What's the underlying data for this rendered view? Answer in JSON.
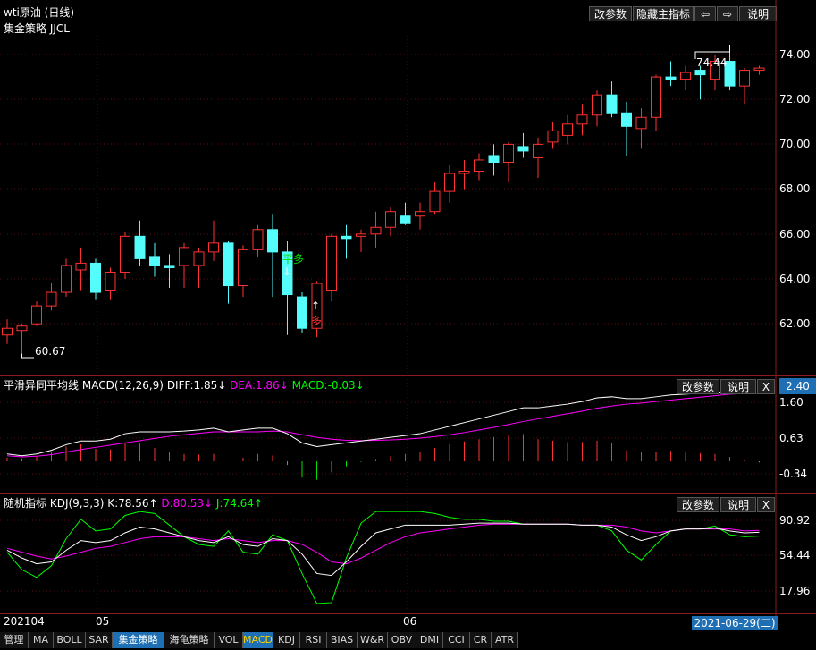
{
  "main": {
    "title": "wti原油 (日线)",
    "subtitle": "集金策略 JJCL",
    "buttons": [
      "改参数",
      "隐藏主指标",
      "⇦",
      "⇨",
      "说明"
    ],
    "y_labels": [
      "74.00",
      "72.00",
      "70.00",
      "68.00",
      "66.00",
      "64.00",
      "62.00"
    ],
    "low_label": "60.67",
    "high_label": "74.44",
    "signal_sell": "平多",
    "signal_buy": "多"
  },
  "macd": {
    "name": "平滑异同平均线",
    "params": "MACD(12,26,9)",
    "diff": "DIFF:1.85↓",
    "dea": "DEA:1.86↓",
    "macd": "MACD:-0.03↓",
    "buttons": [
      "改参数",
      "说明",
      "X"
    ],
    "value_box": "2.40",
    "y_labels": [
      "1.60",
      "0.63",
      "-0.34"
    ]
  },
  "kdj": {
    "name": "随机指标",
    "params": "KDJ(9,3,3)",
    "k": "K:78.56↑",
    "d": "D:80.53↓",
    "j": "J:74.64↑",
    "buttons": [
      "改参数",
      "说明",
      "X"
    ],
    "y_labels": [
      "90.92",
      "54.44",
      "17.96"
    ]
  },
  "x_axis": {
    "labels": [
      "202104",
      "05",
      "06"
    ],
    "date_box": "2021-06-29(二)"
  },
  "tabs": [
    "管理",
    "MA",
    "BOLL",
    "SAR",
    "集金策略",
    "海龟策略",
    "VOL",
    "MACD",
    "KDJ",
    "RSI",
    "BIAS",
    "W&R",
    "OBV",
    "DMI",
    "CCI",
    "CR",
    "ATR"
  ],
  "active_tab": "集金策略",
  "selected_tab": "MACD",
  "colors": {
    "up": "#ff3232",
    "down": "#54fcfc",
    "diff": "#ffffff",
    "dea": "#ff00ff",
    "k": "#ffffff",
    "d": "#ff00ff",
    "j": "#00ff00"
  },
  "chart_data": {
    "type": "candlestick",
    "ylim": [
      60.5,
      75.0
    ],
    "candles": [
      {
        "o": 61.5,
        "h": 62.2,
        "l": 61.1,
        "c": 61.8
      },
      {
        "o": 61.7,
        "h": 62.0,
        "l": 60.67,
        "c": 61.9
      },
      {
        "o": 62.0,
        "h": 63.0,
        "l": 61.9,
        "c": 62.8
      },
      {
        "o": 62.8,
        "h": 63.8,
        "l": 62.6,
        "c": 63.4
      },
      {
        "o": 63.4,
        "h": 64.9,
        "l": 63.2,
        "c": 64.6
      },
      {
        "o": 64.4,
        "h": 65.4,
        "l": 63.5,
        "c": 64.7
      },
      {
        "o": 64.7,
        "h": 64.9,
        "l": 63.1,
        "c": 63.4
      },
      {
        "o": 63.5,
        "h": 64.5,
        "l": 63.1,
        "c": 64.3
      },
      {
        "o": 64.3,
        "h": 66.1,
        "l": 64.0,
        "c": 65.9
      },
      {
        "o": 65.9,
        "h": 66.6,
        "l": 64.6,
        "c": 64.9
      },
      {
        "o": 65.0,
        "h": 65.6,
        "l": 64.1,
        "c": 64.6
      },
      {
        "o": 64.6,
        "h": 65.1,
        "l": 63.6,
        "c": 64.5
      },
      {
        "o": 64.6,
        "h": 65.6,
        "l": 63.6,
        "c": 65.4
      },
      {
        "o": 64.6,
        "h": 65.4,
        "l": 63.6,
        "c": 65.2
      },
      {
        "o": 65.2,
        "h": 66.6,
        "l": 64.8,
        "c": 65.6
      },
      {
        "o": 65.6,
        "h": 65.7,
        "l": 62.9,
        "c": 63.7
      },
      {
        "o": 63.7,
        "h": 65.5,
        "l": 63.2,
        "c": 65.3
      },
      {
        "o": 65.3,
        "h": 66.4,
        "l": 65.0,
        "c": 66.2
      },
      {
        "o": 66.2,
        "h": 66.9,
        "l": 63.2,
        "c": 65.2
      },
      {
        "o": 65.2,
        "h": 65.7,
        "l": 61.5,
        "c": 63.3
      },
      {
        "o": 63.2,
        "h": 63.4,
        "l": 61.6,
        "c": 61.8
      },
      {
        "o": 61.8,
        "h": 63.9,
        "l": 61.4,
        "c": 63.8
      },
      {
        "o": 63.5,
        "h": 66.0,
        "l": 63.0,
        "c": 65.9
      },
      {
        "o": 65.9,
        "h": 66.4,
        "l": 64.9,
        "c": 65.8
      },
      {
        "o": 65.9,
        "h": 66.2,
        "l": 65.2,
        "c": 66.0
      },
      {
        "o": 66.0,
        "h": 67.0,
        "l": 65.4,
        "c": 66.3
      },
      {
        "o": 66.3,
        "h": 67.2,
        "l": 65.9,
        "c": 67.0
      },
      {
        "o": 66.8,
        "h": 67.4,
        "l": 66.4,
        "c": 66.5
      },
      {
        "o": 66.8,
        "h": 67.4,
        "l": 66.2,
        "c": 67.0
      },
      {
        "o": 67.0,
        "h": 68.3,
        "l": 66.9,
        "c": 67.9
      },
      {
        "o": 67.9,
        "h": 69.1,
        "l": 67.4,
        "c": 68.7
      },
      {
        "o": 68.7,
        "h": 69.3,
        "l": 68.0,
        "c": 68.8
      },
      {
        "o": 68.8,
        "h": 69.6,
        "l": 68.4,
        "c": 69.3
      },
      {
        "o": 69.5,
        "h": 70.0,
        "l": 68.6,
        "c": 69.2
      },
      {
        "o": 69.2,
        "h": 70.1,
        "l": 68.3,
        "c": 70.0
      },
      {
        "o": 69.9,
        "h": 70.5,
        "l": 69.4,
        "c": 69.7
      },
      {
        "o": 69.4,
        "h": 70.3,
        "l": 68.5,
        "c": 70.0
      },
      {
        "o": 70.1,
        "h": 71.0,
        "l": 69.8,
        "c": 70.6
      },
      {
        "o": 70.4,
        "h": 71.3,
        "l": 70.0,
        "c": 70.9
      },
      {
        "o": 70.9,
        "h": 71.8,
        "l": 70.4,
        "c": 71.3
      },
      {
        "o": 71.3,
        "h": 72.4,
        "l": 70.8,
        "c": 72.2
      },
      {
        "o": 72.2,
        "h": 72.8,
        "l": 71.2,
        "c": 71.4
      },
      {
        "o": 71.4,
        "h": 71.9,
        "l": 69.5,
        "c": 70.8
      },
      {
        "o": 70.7,
        "h": 71.6,
        "l": 69.8,
        "c": 71.2
      },
      {
        "o": 71.2,
        "h": 73.1,
        "l": 70.6,
        "c": 73.0
      },
      {
        "o": 73.0,
        "h": 73.7,
        "l": 72.6,
        "c": 72.9
      },
      {
        "o": 72.9,
        "h": 73.5,
        "l": 72.4,
        "c": 73.2
      },
      {
        "o": 73.3,
        "h": 73.5,
        "l": 72.0,
        "c": 73.1
      },
      {
        "o": 72.9,
        "h": 74.0,
        "l": 72.4,
        "c": 73.7
      },
      {
        "o": 73.7,
        "h": 74.44,
        "l": 72.4,
        "c": 72.6
      },
      {
        "o": 72.6,
        "h": 73.4,
        "l": 71.8,
        "c": 73.3
      },
      {
        "o": 73.3,
        "h": 73.5,
        "l": 73.1,
        "c": 73.4
      }
    ],
    "macd": {
      "ylim": [
        -0.6,
        2.4
      ],
      "diff": [
        0.2,
        0.15,
        0.2,
        0.3,
        0.45,
        0.55,
        0.55,
        0.6,
        0.75,
        0.8,
        0.8,
        0.8,
        0.82,
        0.85,
        0.9,
        0.8,
        0.85,
        0.9,
        0.9,
        0.75,
        0.5,
        0.4,
        0.45,
        0.5,
        0.55,
        0.6,
        0.65,
        0.7,
        0.75,
        0.85,
        0.95,
        1.05,
        1.15,
        1.25,
        1.35,
        1.45,
        1.45,
        1.5,
        1.55,
        1.62,
        1.72,
        1.75,
        1.7,
        1.7,
        1.75,
        1.8,
        1.82,
        1.85,
        1.88,
        1.88,
        1.86,
        1.85
      ],
      "dea": [
        0.15,
        0.12,
        0.14,
        0.18,
        0.25,
        0.32,
        0.38,
        0.44,
        0.5,
        0.56,
        0.62,
        0.68,
        0.72,
        0.76,
        0.8,
        0.8,
        0.8,
        0.8,
        0.82,
        0.8,
        0.72,
        0.65,
        0.6,
        0.57,
        0.56,
        0.57,
        0.58,
        0.6,
        0.63,
        0.67,
        0.72,
        0.78,
        0.85,
        0.92,
        1.0,
        1.08,
        1.15,
        1.22,
        1.29,
        1.36,
        1.44,
        1.5,
        1.55,
        1.58,
        1.62,
        1.66,
        1.7,
        1.74,
        1.78,
        1.82,
        1.84,
        1.86
      ],
      "hist": [
        0.1,
        0.08,
        0.12,
        0.24,
        0.4,
        0.46,
        0.34,
        0.32,
        0.5,
        0.48,
        0.36,
        0.24,
        0.2,
        0.18,
        0.2,
        0.0,
        0.1,
        0.2,
        0.16,
        -0.1,
        -0.44,
        -0.5,
        -0.3,
        -0.14,
        -0.02,
        0.06,
        0.14,
        0.2,
        0.24,
        0.36,
        0.46,
        0.54,
        0.6,
        0.66,
        0.7,
        0.74,
        0.6,
        0.56,
        0.52,
        0.52,
        0.56,
        0.5,
        0.3,
        0.24,
        0.26,
        0.28,
        0.24,
        0.22,
        0.2,
        0.12,
        0.04,
        -0.03
      ]
    },
    "kdj": {
      "ylim": [
        5,
        100
      ],
      "k": [
        60,
        52,
        46,
        48,
        60,
        70,
        68,
        70,
        78,
        84,
        82,
        78,
        74,
        70,
        68,
        74,
        66,
        64,
        72,
        70,
        56,
        36,
        34,
        48,
        64,
        78,
        82,
        86,
        86,
        86,
        86,
        87,
        88,
        88,
        88,
        87,
        87,
        87,
        87,
        86,
        86,
        84,
        76,
        70,
        74,
        80,
        82,
        82,
        83,
        80,
        78,
        78.56
      ],
      "d": [
        62,
        58,
        54,
        51,
        54,
        58,
        62,
        64,
        68,
        72,
        74,
        74,
        74,
        72,
        70,
        72,
        70,
        68,
        70,
        70,
        66,
        58,
        48,
        46,
        52,
        60,
        68,
        74,
        78,
        80,
        82,
        84,
        86,
        87,
        87,
        87,
        87,
        87,
        87,
        86,
        86,
        86,
        84,
        80,
        78,
        80,
        82,
        82,
        82,
        82,
        80,
        80.53
      ],
      "j": [
        58,
        40,
        32,
        44,
        72,
        92,
        80,
        82,
        96,
        104,
        98,
        86,
        74,
        66,
        64,
        80,
        58,
        56,
        76,
        70,
        36,
        -4,
        6,
        52,
        88,
        114,
        112,
        110,
        102,
        98,
        94,
        92,
        92,
        90,
        90,
        87,
        87,
        87,
        87,
        86,
        86,
        80,
        60,
        50,
        66,
        80,
        82,
        82,
        85,
        76,
        74,
        74.64
      ]
    }
  }
}
